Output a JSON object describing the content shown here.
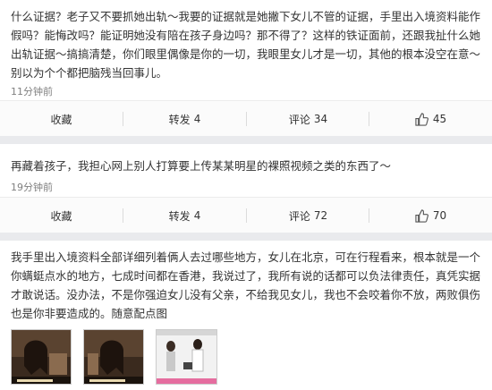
{
  "comments": [
    {
      "text": "什么证据？老子又不要抓她出轨～我要的证据就是她撇下女儿不管的证据，手里出入境资料能作假吗？能悔改吗？能证明她没有陪在孩子身边吗？那不得了？这样的铁证面前，还跟我扯什么她出轨证据～搞搞清楚，你们眼里偶像是你的一切，我眼里女儿才是一切，其他的根本没空在意～别以为个个都把脑残当回事儿。",
      "time": "11分钟前",
      "actions": {
        "fav": "收藏",
        "repost": "转发",
        "repost_count": "4",
        "comment": "评论",
        "comment_count": "34",
        "like_count": "45"
      }
    },
    {
      "text": "再藏着孩子，我担心网上别人打算要上传某某明星的裸照视频之类的东西了～",
      "time": "19分钟前",
      "actions": {
        "fav": "收藏",
        "repost": "转发",
        "repost_count": "4",
        "comment": "评论",
        "comment_count": "72",
        "like_count": "70"
      }
    },
    {
      "text": "我手里出入境资料全部详细列着俩人去过哪些地方，女儿在北京，可在行程看来，根本就是一个你螨蜓点水的地方，七成时间都在香港，我说过了，我所有说的话都可以负法律责任，真凭实据才敢说话。没办法，不是你强迫女儿没有父亲，不给我见女儿，我也不会咬着你不放，两败俱伤也是你非要造成的。随意配点图"
    }
  ],
  "colors": {
    "background": "#e9eaed",
    "card": "#ffffff",
    "text": "#333333",
    "muted": "#808080"
  }
}
